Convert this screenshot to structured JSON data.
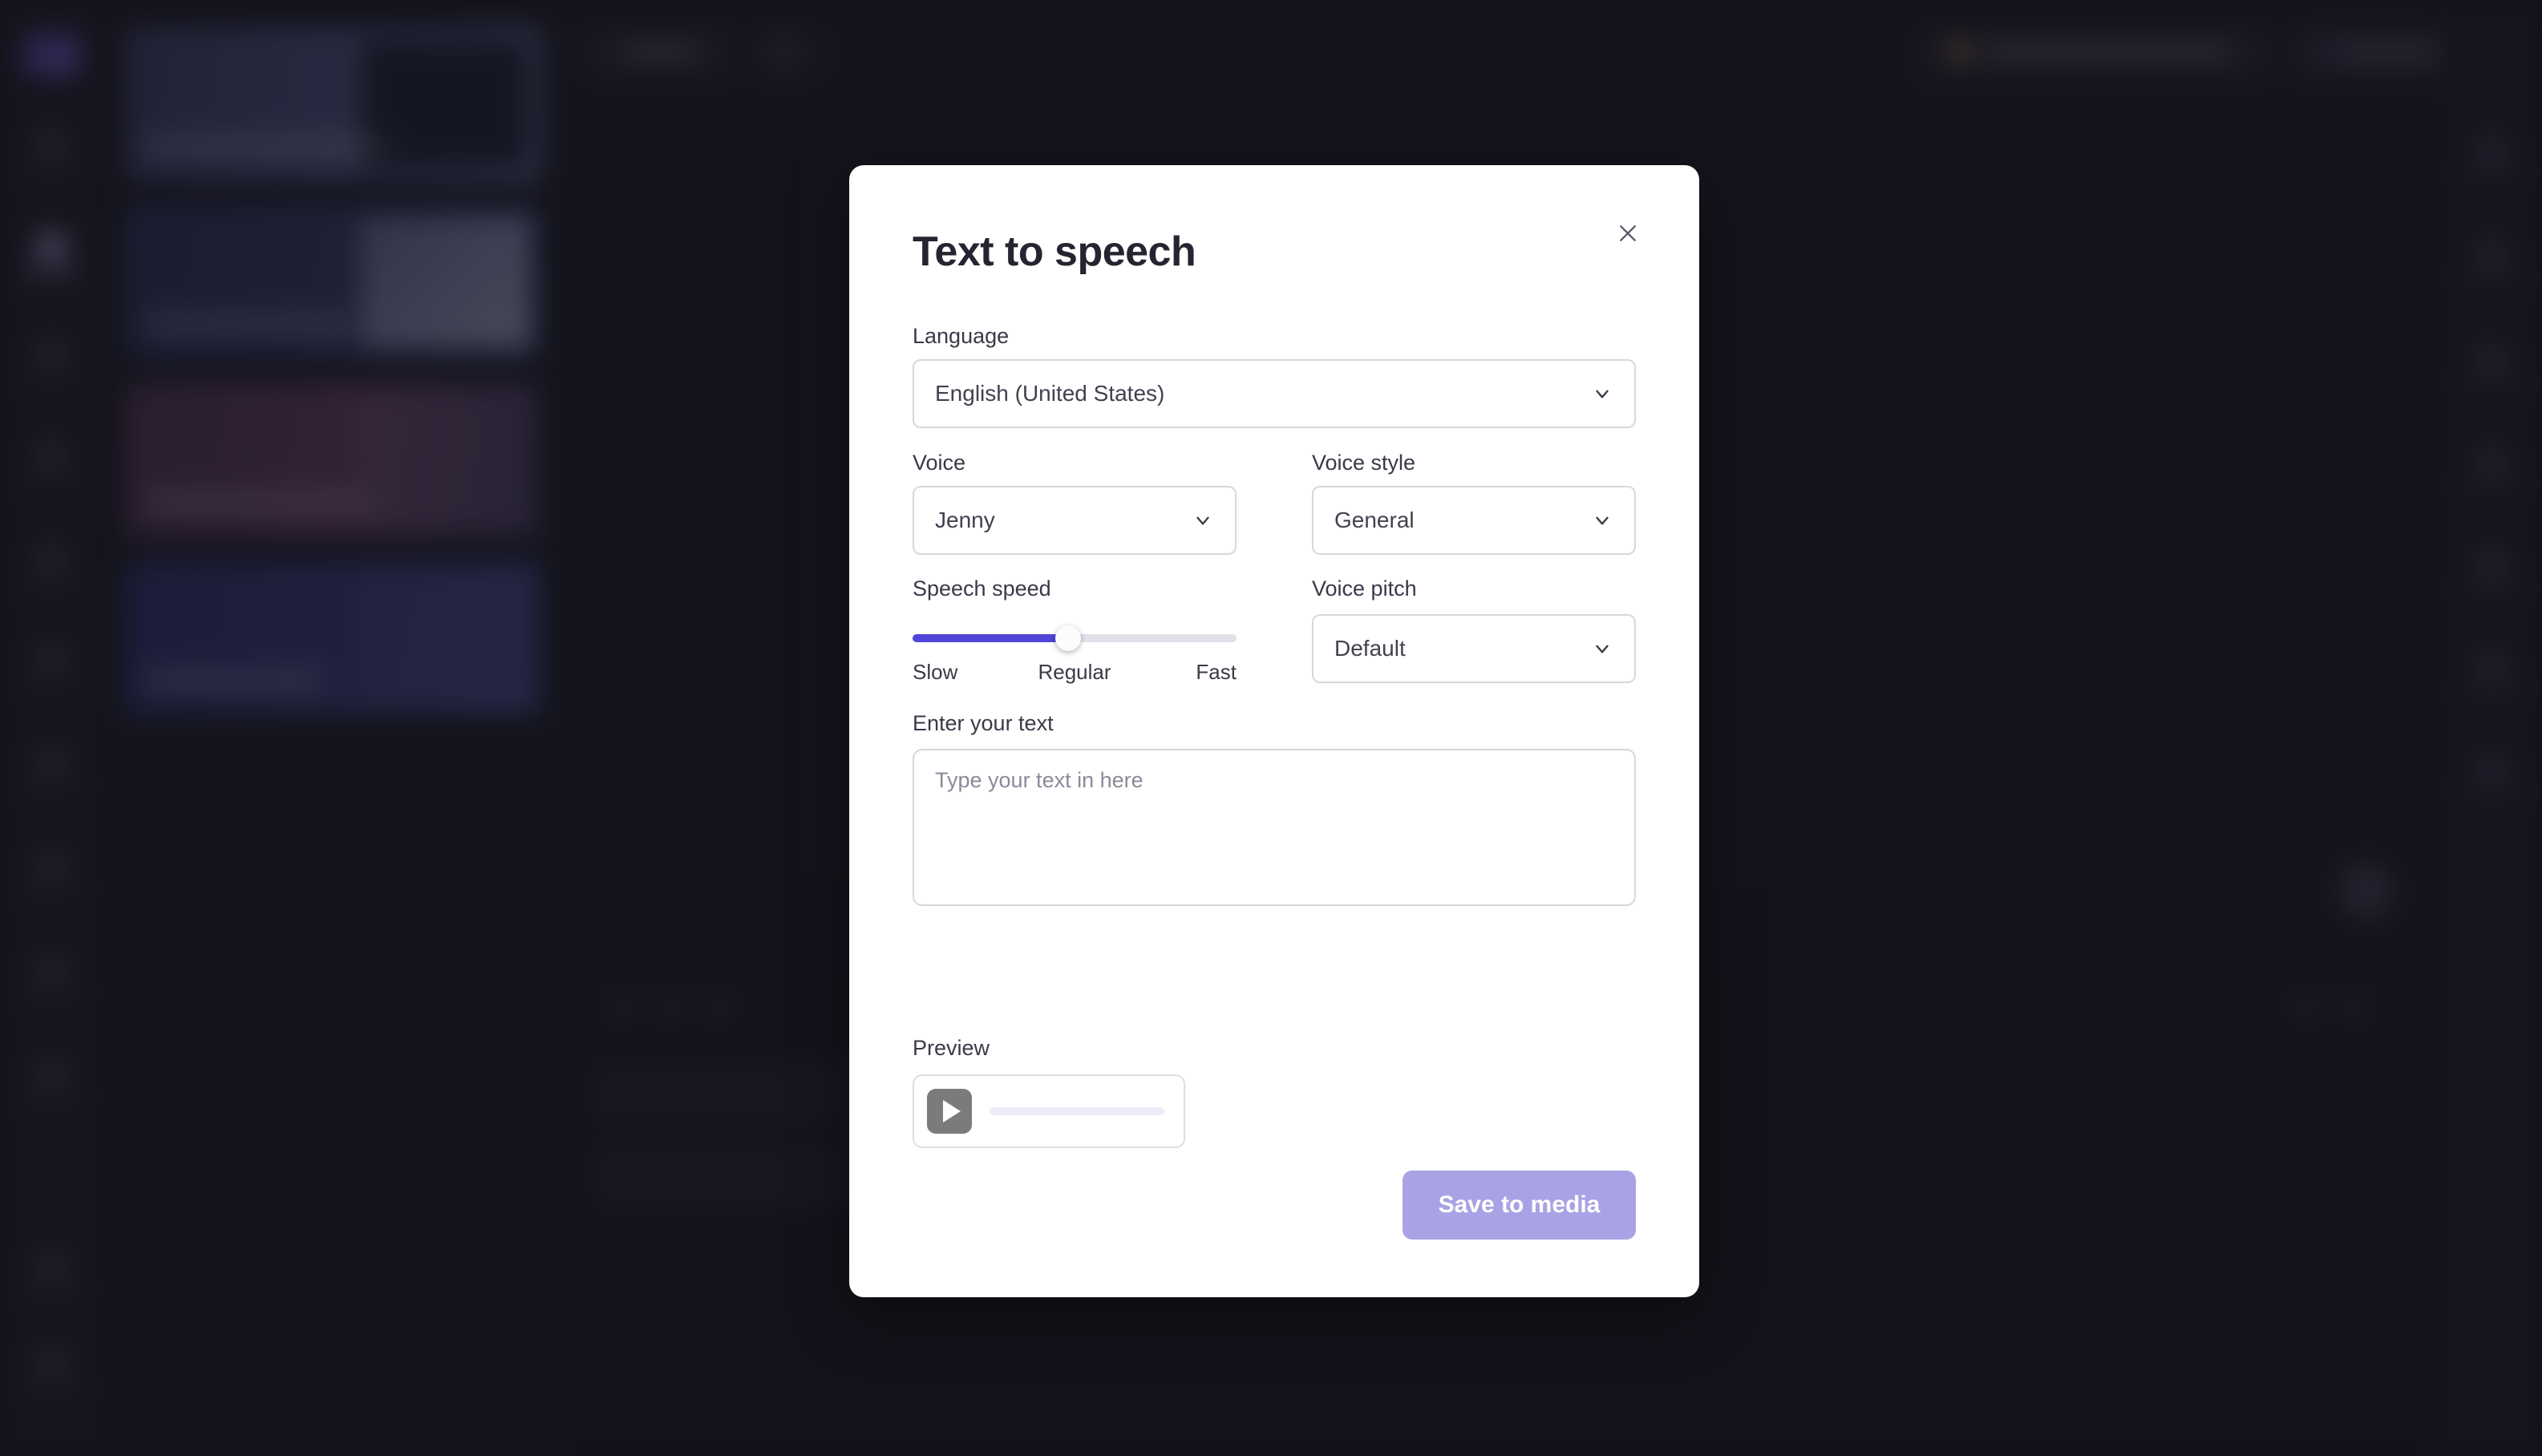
{
  "modal": {
    "title": "Text to speech",
    "close_icon": "close-icon",
    "language": {
      "label": "Language",
      "value": "English (United States)"
    },
    "voice": {
      "label": "Voice",
      "value": "Jenny"
    },
    "voice_style": {
      "label": "Voice style",
      "value": "General"
    },
    "voice_pitch": {
      "label": "Voice pitch",
      "value": "Default"
    },
    "speech_speed": {
      "label": "Speech speed",
      "percent": 48,
      "ticks": {
        "slow": "Slow",
        "regular": "Regular",
        "fast": "Fast"
      }
    },
    "text_entry": {
      "label": "Enter your text",
      "placeholder": "Type your text in here",
      "value": ""
    },
    "preview": {
      "label": "Preview",
      "play_icon": "play-icon",
      "progress_percent": 0
    },
    "save_button": {
      "label": "Save to media"
    },
    "colors": {
      "slider_fill": "#5146d8",
      "save_button_bg": "#a9a2e4",
      "modal_bg": "#ffffff",
      "title_text": "#252430"
    }
  },
  "background": {
    "app_bg": "#1a1a24",
    "rail_bg": "#1d1d28",
    "panel_bg": "#1b1b25",
    "note": "background editor UI is blurred behind the modal overlay"
  }
}
